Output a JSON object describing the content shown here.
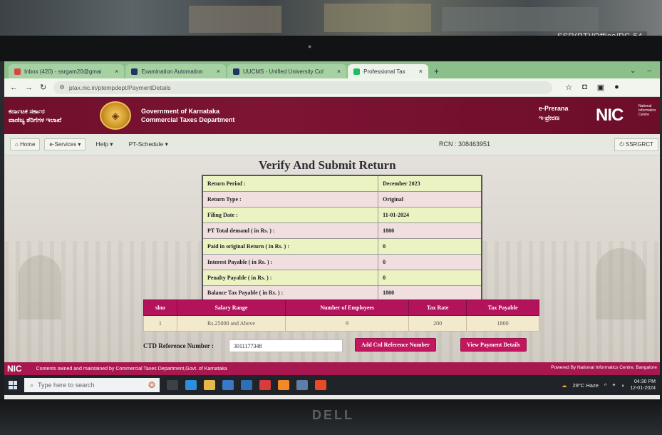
{
  "environment": {
    "sticker": "SSR(PT)/Office/PC-54",
    "monitor_brand": "DELL"
  },
  "browser": {
    "tabs": [
      {
        "label": "Inbox (420) - ssrgam20@gmai",
        "active": false
      },
      {
        "label": "Examination Automation",
        "active": false
      },
      {
        "label": "UUCMS - Unified University Col",
        "active": false
      },
      {
        "label": "Professional Tax",
        "active": true
      }
    ],
    "url": "ptax.nic.in/ptempdept/PaymentDetails"
  },
  "header": {
    "kannada_line1": "ವಾಣಿಜ್ಯ ತೆರಿಗೆಗಳ ಇಲಾಖೆ",
    "kannada_line2": "ಕರ್ನಾಟಕ ಸರ್ಕಾರ",
    "gov_line1": "Government of Karnataka",
    "gov_line2": "Commercial Taxes Department",
    "eprerana_line1": "e-Prerana",
    "eprerana_line2": "ಇ-ಪ್ರೇರಣ",
    "nic": "NIC",
    "nic_sub": "National Informatics Centre"
  },
  "nav": {
    "home": "Home",
    "eservices": "e-Services",
    "help": "Help",
    "pt_schedule": "PT-Schedule",
    "rcn": "RCN : 308463951",
    "user": "SSRGRCT"
  },
  "page": {
    "title": "Verify And Submit Return",
    "summary": [
      {
        "label": "Return Period :",
        "value": "December 2023"
      },
      {
        "label": "Return Type :",
        "value": "Original"
      },
      {
        "label": "Filing Date :",
        "value": "11-01-2024"
      },
      {
        "label": "PT Total demand ( in Rs. ) :",
        "value": "1800"
      },
      {
        "label": "Paid in original Return ( in Rs. ) :",
        "value": "0"
      },
      {
        "label": "Interest Payable ( in Rs. ) :",
        "value": "0"
      },
      {
        "label": "Penalty Payable ( in Rs. ) :",
        "value": "0"
      },
      {
        "label": "Balance Tax Payable ( in Rs. ) :",
        "value": "1800"
      }
    ],
    "salary_table": {
      "headers": [
        "slno",
        "Salary Range",
        "Number of Employees",
        "Tax Rate",
        "Tax Payable"
      ],
      "rows": [
        [
          "1",
          "Rs.25000 and Above",
          "9",
          "200",
          "1800"
        ]
      ]
    },
    "ctd_label": "CTD Reference Number :",
    "ctd_value": "3011177348",
    "add_ctd_button": "Add Ctd Reference Number",
    "view_payment_button": "View Payment Details"
  },
  "footer": {
    "left": "Contents owned and maintained by Commercial Taxes Department,Govt. of Karnataka",
    "right": "Powered By National Informatics Centre, Bangalore",
    "logo": "NIC"
  },
  "taskbar": {
    "search_placeholder": "Type here to search",
    "weather": "29°C Haze",
    "time": "04:30 PM",
    "date": "12-01-2024"
  }
}
